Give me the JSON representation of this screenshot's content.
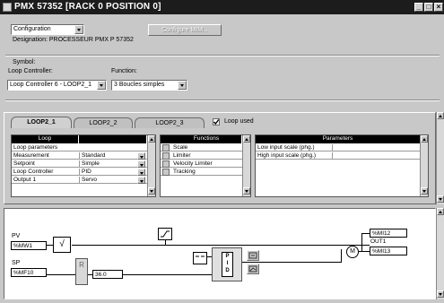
{
  "window": {
    "title": "PMX 57352 [RACK 0    POSITION 0]",
    "controls": [
      "_",
      "□",
      "×"
    ]
  },
  "toolbar": {
    "mode_value": "Configuration",
    "configure_button": "Configure MIM...",
    "designation": "Designation: PROCESSEUR PMX P 57352"
  },
  "symbol": {
    "group_label": "Symbol:",
    "loop_controller_label": "Loop Controller:",
    "loop_controller_value": "Loop Controller 6 - LOOP2_1",
    "function_label": "Function:",
    "function_value": "3 Boucles simples"
  },
  "tabs": [
    {
      "label": "LOOP2_1",
      "active": true
    },
    {
      "label": "LOOP2_2",
      "active": false
    },
    {
      "label": "LOOP2_3",
      "active": false
    }
  ],
  "loop_used": {
    "label": "Loop used",
    "checked": true
  },
  "loop_table": {
    "header": "Loop",
    "rows": [
      {
        "name": "Loop parameters",
        "value": "",
        "combo": false
      },
      {
        "name": "Measurement",
        "value": "Standard",
        "combo": true
      },
      {
        "name": "Setpoint",
        "value": "Simple",
        "combo": true
      },
      {
        "name": "Loop Controller",
        "value": "PID",
        "combo": true
      },
      {
        "name": "Output 1",
        "value": "Servo",
        "combo": true
      }
    ]
  },
  "functions_table": {
    "header": "Functions",
    "rows": [
      "Scale",
      "Limiter",
      "Velocity Limiter",
      "Tracking"
    ]
  },
  "parameters_table": {
    "header": "Parameters",
    "rows": [
      "Low input scale (phg.)",
      "High input scale (phg.)"
    ]
  },
  "diagram": {
    "pv_label": "PV",
    "pv_var": "%MW1",
    "sqrt_symbol": "√",
    "sp_label": "SP",
    "sp_var": "%MF10",
    "ramp_label": "R",
    "const_value": "36.0",
    "pid_label": "P\nI\nD",
    "mux_label": "M",
    "out_var_top": "%MI12",
    "out_label": "OUT1",
    "out_var_bottom": "%MI13"
  }
}
